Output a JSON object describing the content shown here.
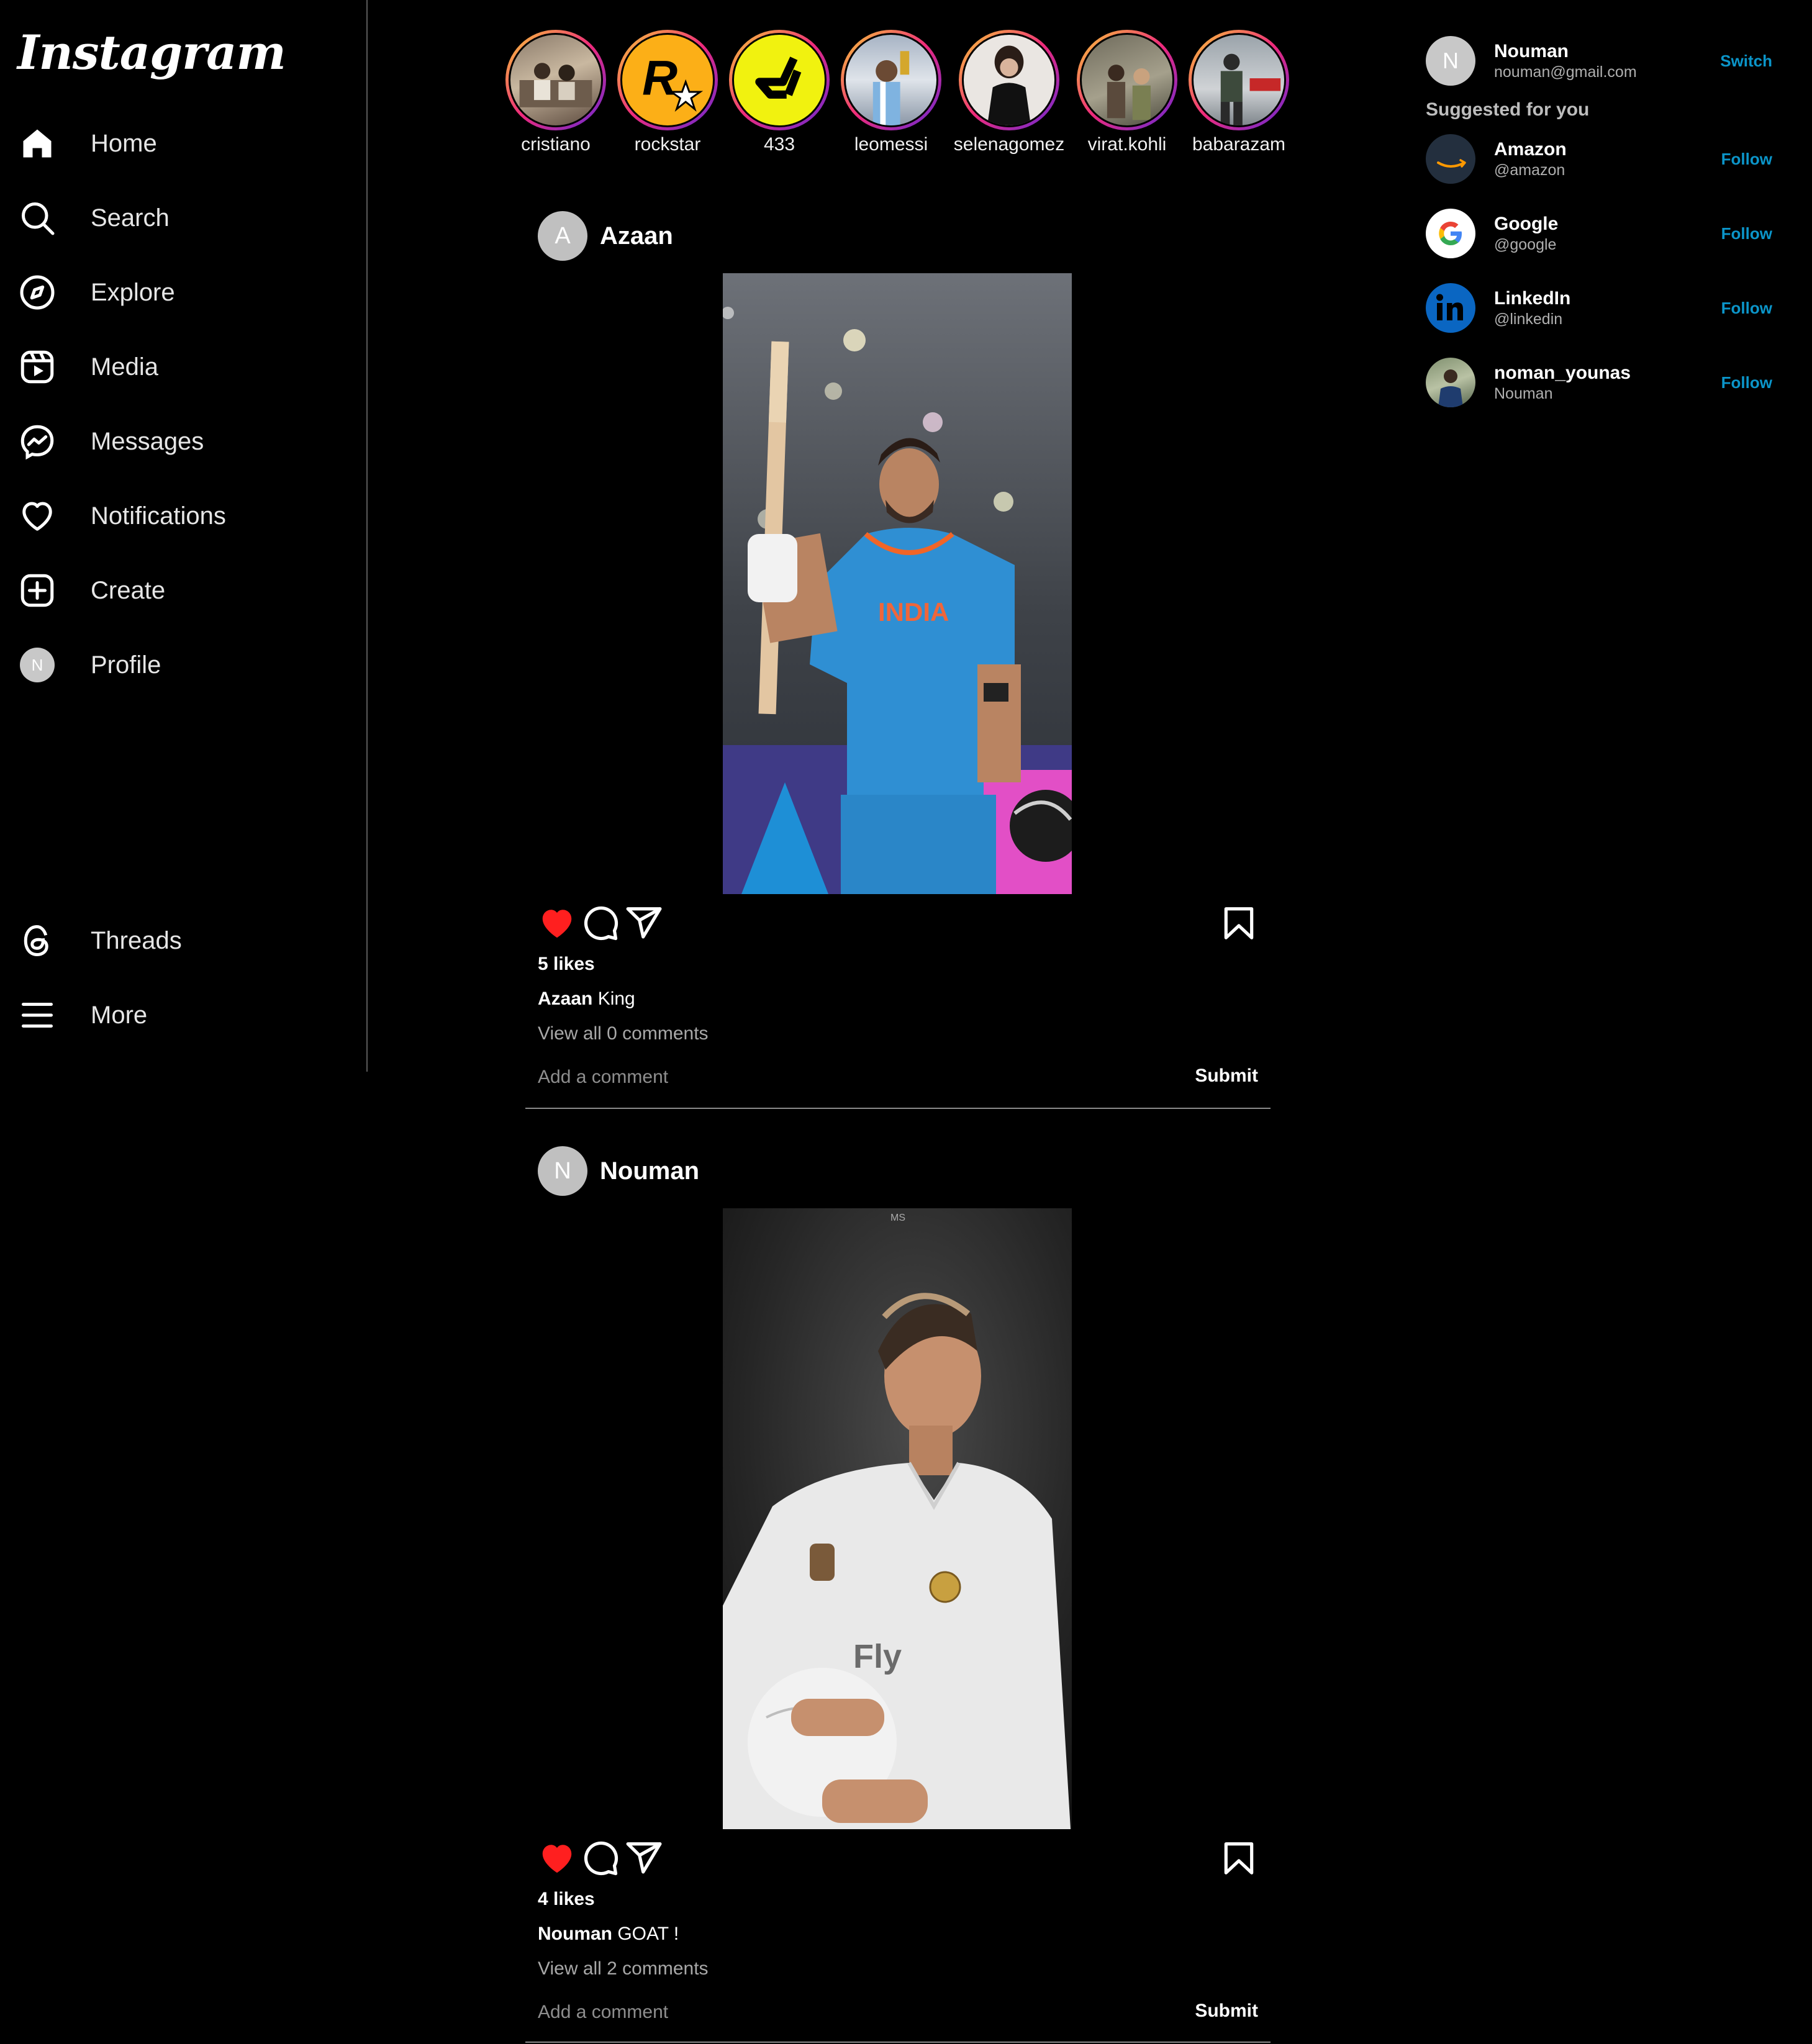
{
  "app": {
    "logo": "Instagram"
  },
  "sidebar": {
    "items": [
      {
        "label": "Home",
        "icon": "home-icon"
      },
      {
        "label": "Search",
        "icon": "search-icon"
      },
      {
        "label": "Explore",
        "icon": "compass-icon"
      },
      {
        "label": "Media",
        "icon": "reels-icon"
      },
      {
        "label": "Messages",
        "icon": "messenger-icon"
      },
      {
        "label": "Notifications",
        "icon": "heart-icon"
      },
      {
        "label": "Create",
        "icon": "plus-square-icon"
      },
      {
        "label": "Profile",
        "icon": "avatar",
        "avatar_letter": "N"
      }
    ],
    "bottom_items": [
      {
        "label": "Threads",
        "icon": "threads-icon"
      },
      {
        "label": "More",
        "icon": "menu-icon"
      }
    ]
  },
  "stories": [
    {
      "username": "cristiano"
    },
    {
      "username": "rockstar"
    },
    {
      "username": "433"
    },
    {
      "username": "leomessi"
    },
    {
      "username": "selenagomez"
    },
    {
      "username": "virat.kohli"
    },
    {
      "username": "babarazam"
    }
  ],
  "posts": [
    {
      "avatar_letter": "A",
      "username": "Azaan",
      "likes": "5 likes",
      "caption_user": "Azaan",
      "caption_text": " King",
      "view_comments": "View all 0 comments",
      "comment_placeholder": "Add a comment",
      "submit_label": "Submit",
      "liked": true
    },
    {
      "avatar_letter": "N",
      "username": "Nouman",
      "likes": "4 likes",
      "caption_user": "Nouman",
      "caption_text": " GOAT !",
      "view_comments": "View all 2 comments",
      "comment_placeholder": "Add a comment",
      "submit_label": "Submit",
      "liked": true
    }
  ],
  "right_panel": {
    "current_user": {
      "avatar_letter": "N",
      "name": "Nouman",
      "email": "nouman@gmail.com",
      "action": "Switch"
    },
    "suggested_title": "Suggested for you",
    "suggestions": [
      {
        "name": "Amazon",
        "handle": "@amazon",
        "action": "Follow"
      },
      {
        "name": "Google",
        "handle": "@google",
        "action": "Follow"
      },
      {
        "name": "LinkedIn",
        "handle": "@linkedin",
        "action": "Follow"
      },
      {
        "name": "noman_younas",
        "handle": "Nouman",
        "action": "Follow"
      }
    ]
  },
  "colors": {
    "background": "#000000",
    "link_blue": "#0b95c9",
    "like_red": "#ff1f1f",
    "divider": "#5a5a5a"
  }
}
